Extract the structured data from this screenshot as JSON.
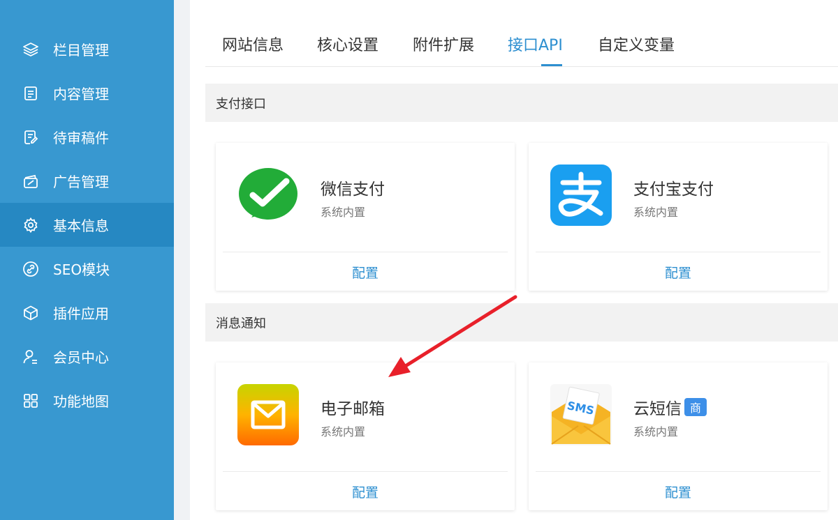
{
  "sidebar": {
    "items": [
      {
        "label": "栏目管理",
        "icon": "layers-icon"
      },
      {
        "label": "内容管理",
        "icon": "document-icon"
      },
      {
        "label": "待审稿件",
        "icon": "edit-document-icon"
      },
      {
        "label": "广告管理",
        "icon": "ad-icon"
      },
      {
        "label": "基本信息",
        "icon": "gear-icon",
        "active": true
      },
      {
        "label": "SEO模块",
        "icon": "link-icon"
      },
      {
        "label": "插件应用",
        "icon": "cube-icon"
      },
      {
        "label": "会员中心",
        "icon": "user-icon"
      },
      {
        "label": "功能地图",
        "icon": "grid-icon"
      }
    ]
  },
  "tabs": [
    {
      "label": "网站信息"
    },
    {
      "label": "核心设置"
    },
    {
      "label": "附件扩展"
    },
    {
      "label": "接口API",
      "active": true
    },
    {
      "label": "自定义变量"
    }
  ],
  "sections": {
    "payment": {
      "title": "支付接口",
      "cards": [
        {
          "name": "微信支付",
          "sub": "系统内置",
          "action": "配置",
          "icon": "wechat-pay-icon"
        },
        {
          "name": "支付宝支付",
          "sub": "系统内置",
          "action": "配置",
          "icon": "alipay-icon"
        }
      ]
    },
    "notify": {
      "title": "消息通知",
      "cards": [
        {
          "name": "电子邮箱",
          "sub": "系统内置",
          "action": "配置",
          "icon": "email-icon"
        },
        {
          "name": "云短信",
          "badge": "商",
          "sub": "系统内置",
          "action": "配置",
          "icon": "sms-icon",
          "icon_text": "SMS"
        }
      ]
    }
  },
  "colors": {
    "sidebar_bg": "#3898d0",
    "sidebar_active": "#2688c2",
    "accent": "#2d8fd0",
    "annotation_arrow": "#e8202a"
  }
}
